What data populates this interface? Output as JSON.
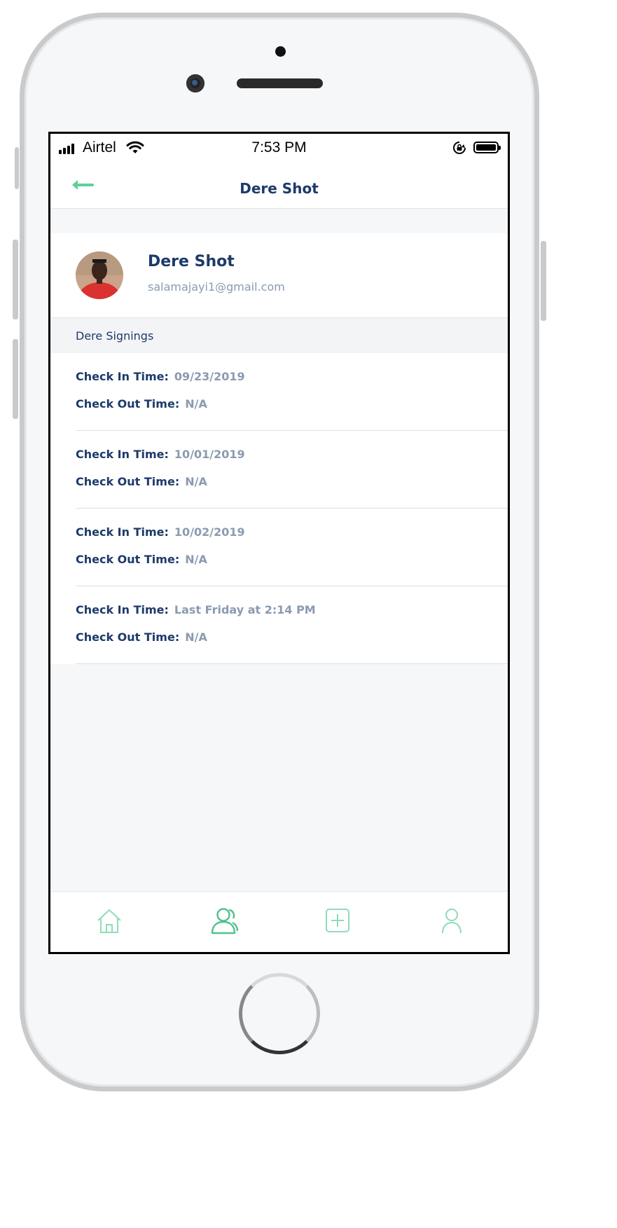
{
  "statusbar": {
    "carrier": "Airtel",
    "time": "7:53 PM"
  },
  "nav": {
    "title": "Dere Shot",
    "back_icon": "arrow-left-icon"
  },
  "profile": {
    "name": "Dere Shot",
    "email": "salamajayi1@gmail.com"
  },
  "section": {
    "title": "Dere Signings"
  },
  "signings": [
    {
      "in_label": "Check In Time:",
      "in_value": "09/23/2019",
      "out_label": "Check Out Time:",
      "out_value": "N/A"
    },
    {
      "in_label": "Check In Time:",
      "in_value": "10/01/2019",
      "out_label": "Check Out Time:",
      "out_value": "N/A"
    },
    {
      "in_label": "Check In Time:",
      "in_value": "10/02/2019",
      "out_label": "Check Out Time:",
      "out_value": "N/A"
    },
    {
      "in_label": "Check In Time:",
      "in_value": "Last Friday at 2:14 PM",
      "out_label": "Check Out Time:",
      "out_value": "N/A"
    }
  ],
  "tabs": [
    {
      "icon": "home-icon"
    },
    {
      "icon": "users-icon"
    },
    {
      "icon": "add-square-icon"
    },
    {
      "icon": "profile-icon"
    }
  ],
  "colors": {
    "accent": "#5fcf9c",
    "title": "#1d3a6a",
    "muted": "#8a9bb0",
    "background": "#f6f7f9"
  }
}
